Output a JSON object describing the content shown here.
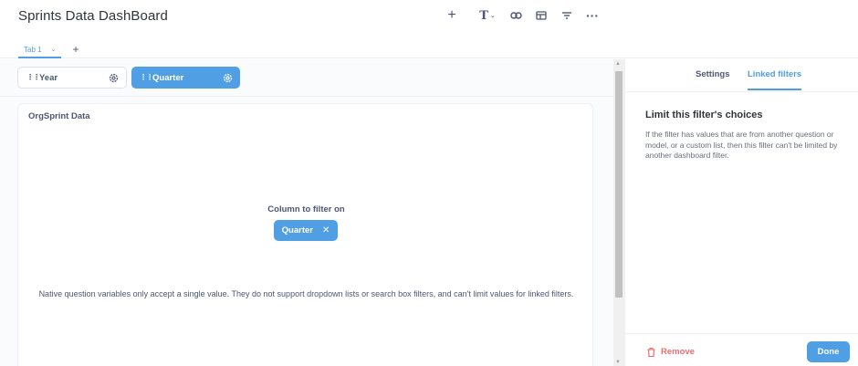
{
  "header": {
    "title": "Sprints Data DashBoard",
    "toolbar": {
      "add_icon": "plus-icon",
      "text_icon": "text-icon",
      "text_glyph": "T",
      "link_icon": "link-icon",
      "card_icon": "card-icon",
      "filter_icon": "filter-icon",
      "more_icon": "ellipsis-icon"
    }
  },
  "tabs": {
    "items": [
      {
        "label": "Tab 1"
      }
    ],
    "add_label": "+"
  },
  "filters": [
    {
      "label": "Year",
      "active": false
    },
    {
      "label": "Quarter",
      "active": true
    }
  ],
  "card": {
    "title": "OrgSprint Data",
    "column_label": "Column to filter on",
    "column_value": "Quarter",
    "note": "Native question variables only accept a single value. They do not support dropdown lists or search box filters, and can't limit values for linked filters."
  },
  "sidebar": {
    "tabs": [
      {
        "label": "Settings",
        "active": false
      },
      {
        "label": "Linked filters",
        "active": true
      }
    ],
    "heading": "Limit this filter's choices",
    "description": "If the filter has values that are from another question or model, or a custom list, then this filter can't be limited by another dashboard filter.",
    "remove_label": "Remove",
    "done_label": "Done"
  },
  "colors": {
    "accent": "#509ee3",
    "danger": "#ed6e6e",
    "text": "#4c5773",
    "background": "#f9fbfc"
  }
}
